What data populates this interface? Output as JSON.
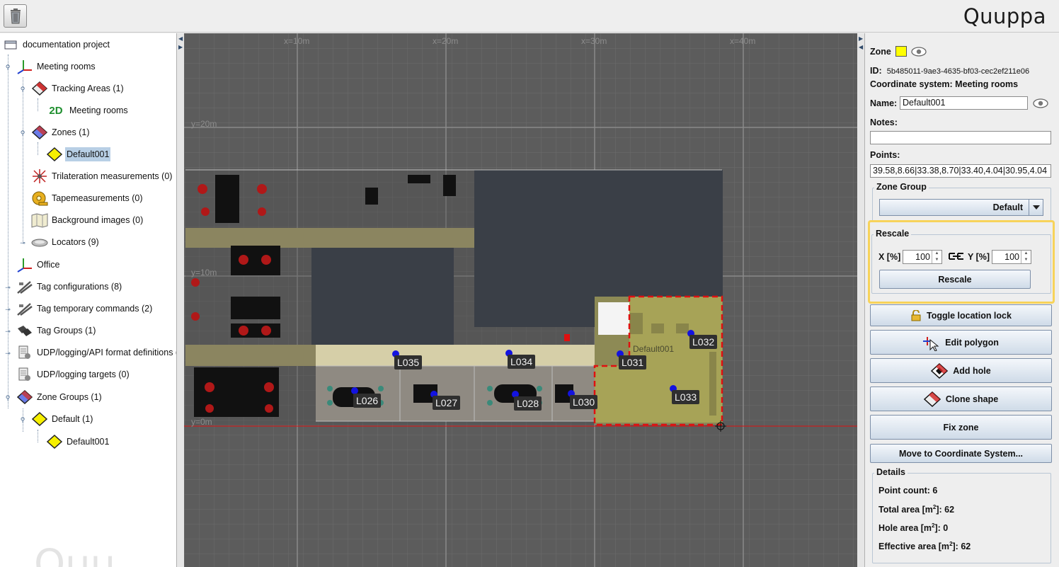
{
  "toolbar": {
    "trash_icon": "trash-icon",
    "logo_text": "Quuppa"
  },
  "tree": {
    "root": "documentation project",
    "items": [
      {
        "label": "Meeting rooms",
        "icon": "coordinate-axes-icon"
      },
      {
        "label": "Tracking Areas (1)",
        "icon": "diamond-outline-icon"
      },
      {
        "label": "Meeting rooms",
        "prefix": "2D",
        "icon": "2d-area-icon"
      },
      {
        "label": "Zones (1)",
        "icon": "blue-diamond-icon"
      },
      {
        "label": "Default001",
        "icon": "yellow-diamond-icon"
      },
      {
        "label": "Trilateration measurements (0)",
        "icon": "starburst-icon"
      },
      {
        "label": "Tapemeasurements (0)",
        "icon": "tape-measure-icon"
      },
      {
        "label": "Background images (0)",
        "icon": "map-image-icon"
      },
      {
        "label": "Locators (9)",
        "icon": "locator-icon"
      },
      {
        "label": "Office",
        "icon": "coordinate-axes-icon"
      },
      {
        "label": "Tag configurations (8)",
        "icon": "tag-config-icon"
      },
      {
        "label": "Tag temporary commands (2)",
        "icon": "tag-config-icon"
      },
      {
        "label": "Tag Groups (1)",
        "icon": "tag-group-icon"
      },
      {
        "label": "UDP/logging/API format definitions (",
        "icon": "udp-format-icon"
      },
      {
        "label": "UDP/logging targets (0)",
        "icon": "udp-target-icon"
      },
      {
        "label": "Zone Groups (1)",
        "icon": "blue-diamond-icon"
      },
      {
        "label": "Default (1)",
        "icon": "yellow-diamond-icon"
      },
      {
        "label": "Default001",
        "icon": "yellow-diamond-icon"
      }
    ],
    "watermark": "Quu"
  },
  "canvas": {
    "x_axis": [
      "x=10m",
      "x=20m",
      "x=30m",
      "x=40m"
    ],
    "y_axis": [
      "y=20m",
      "y=10m",
      "y=0m"
    ],
    "zone_label": "Default001",
    "locators": [
      "L035",
      "L034",
      "L031",
      "L032",
      "L026",
      "L027",
      "L028",
      "L030",
      "L033"
    ]
  },
  "panel": {
    "zone_title": "Zone",
    "zone_color": "#ffff00",
    "id_label": "ID:",
    "id_value": "5b485011-9ae3-4635-bf03-cec2ef211e06",
    "coord_system": "Coordinate system: Meeting rooms",
    "name_label": "Name:",
    "name_value": "Default001",
    "notes_label": "Notes:",
    "notes_value": "",
    "points_label": "Points:",
    "points_value": "39.58,8.66|33.38,8.70|33.40,4.04|30.95,4.04",
    "zone_group_title": "Zone Group",
    "zone_group_value": "Default",
    "rescale_title": "Rescale",
    "x_label": "X [%]",
    "x_value": "100",
    "y_label": "Y [%]",
    "y_value": "100",
    "rescale_button": "Rescale",
    "highlight_color": "#f7d35a",
    "buttons": {
      "toggle_lock": "Toggle location lock",
      "edit_polygon": "Edit polygon",
      "add_hole": "Add hole",
      "clone_shape": "Clone shape",
      "fix_zone": "Fix zone",
      "move_coord": "Move to Coordinate System..."
    },
    "details": {
      "title": "Details",
      "point_count_label": "Point count:",
      "point_count": "6",
      "total_area_label": "Total area [m",
      "total_area": "62",
      "hole_area_label": "Hole area [m",
      "hole_area": "0",
      "effective_area_label": "Effective area [m",
      "effective_area": "62",
      "unit_suffix": "]:",
      "exp": "2"
    }
  }
}
